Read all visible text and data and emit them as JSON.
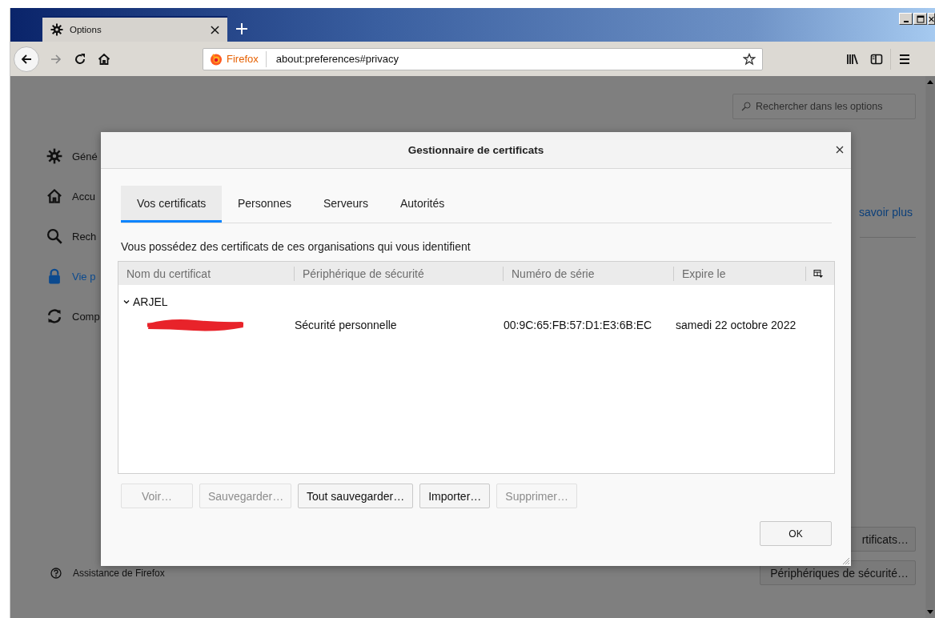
{
  "browser_tab": {
    "title": "Options",
    "selected": true
  },
  "address_bar": {
    "identity": "Firefox",
    "url": "about:preferences#privacy"
  },
  "page": {
    "sidebar": [
      {
        "kind": "gear",
        "label": "Géné",
        "selected": false
      },
      {
        "kind": "home",
        "label": "Accu",
        "selected": false
      },
      {
        "kind": "search",
        "label": "Rech",
        "selected": false
      },
      {
        "kind": "lock",
        "label": "Vie p",
        "selected": true
      },
      {
        "kind": "sync",
        "label": "Comp",
        "selected": false
      }
    ],
    "search": {
      "placeholder": "Rechercher dans les options"
    },
    "learn_more_link": "savoir plus",
    "buttons": [
      {
        "label": "rtificats…"
      },
      {
        "label": "Périphériques de sécurité…"
      }
    ],
    "support_link": "Assistance de Firefox"
  },
  "dialog": {
    "title": "Gestionnaire de certificats",
    "tabs": [
      {
        "label": "Vos certificats",
        "selected": true
      },
      {
        "label": "Personnes",
        "selected": false
      },
      {
        "label": "Serveurs",
        "selected": false
      },
      {
        "label": "Autorités",
        "selected": false
      }
    ],
    "description": "Vous possédez des certificats de ces organisations qui vous identifient",
    "table": {
      "columns": [
        "Nom du certificat",
        "Périphérique de sécurité",
        "Numéro de série",
        "Expire le"
      ],
      "rows": [
        {
          "name": "ARJEL",
          "expanded": true,
          "children": [
            {
              "redacted": true,
              "cells": [
                "Sécurité personnelle",
                "00:9C:65:FB:57:D1:E3:6B:EC",
                "samedi 22 octobre 2022"
              ]
            }
          ]
        }
      ]
    },
    "buttons": [
      {
        "label": "Voir…",
        "disabled": true
      },
      {
        "label": "Sauvegarder…",
        "disabled": true
      },
      {
        "label": "Tout sauvegarder…",
        "disabled": false
      },
      {
        "label": "Importer…",
        "disabled": false
      },
      {
        "label": "Supprimer…",
        "disabled": true
      }
    ],
    "ok_button": "OK"
  }
}
